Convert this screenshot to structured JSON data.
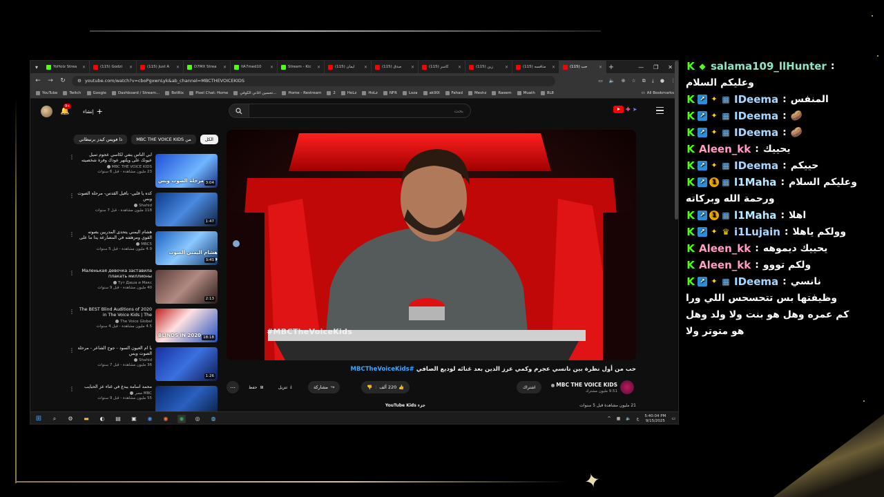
{
  "browser": {
    "tabs": [
      {
        "label": "YoHolz Strea",
        "color": "#53fc18"
      },
      {
        "label": "(115) Godzi",
        "color": "#ff0000"
      },
      {
        "label": "(115) Just A",
        "color": "#ff0000"
      },
      {
        "label": "D7MX Strea",
        "color": "#53fc18"
      },
      {
        "label": "llA7med10",
        "color": "#53fc18"
      },
      {
        "label": "Stream - Kic",
        "color": "#53fc18"
      },
      {
        "label": "(115) ايمان",
        "color": "#ff0000"
      },
      {
        "label": "(115) صدق",
        "color": "#ff0000"
      },
      {
        "label": "(115) كاسر",
        "color": "#ff0000"
      },
      {
        "label": "(115) زين",
        "color": "#ff0000"
      },
      {
        "label": "(115) منافسه",
        "color": "#ff0000"
      },
      {
        "label": "(115) حب",
        "color": "#ff0000",
        "active": true
      }
    ],
    "url": "youtube.com/watch?v=cboPgxwnLyk&ab_channel=MBCTHEVOICEKIDS",
    "bookmarks": [
      "YouTube",
      "Twitch",
      "Google",
      "Dashboard / Stream...",
      "BotRix",
      "Pixel Chat: Home",
      "تحسين اغاني الكوفي...",
      "Home - Restream",
      "2",
      "HoLz",
      "HoLz",
      "NFR",
      "Loza",
      "ak90l",
      "Fahad",
      "Meshz",
      "Raeem",
      "Muath",
      "8L8"
    ],
    "all_bookmarks": "All Bookmarks"
  },
  "youtube": {
    "search_placeholder": "بحث",
    "create_label": "إنشاء",
    "notification_count": "9+",
    "chips": [
      {
        "label": "الكل",
        "active": true
      },
      {
        "label": "من MBC THE VOICE KIDS",
        "active": false
      },
      {
        "label": "ذا فويس كيدز برنبطاني",
        "active": false
      }
    ],
    "recommendations": [
      {
        "title": "أبي الناس ينفي لكاسي عجوم تميل عيونك على ويلتهر عودك وفرة شخصيته",
        "channel": "MBC THE VOICE KIDS",
        "views": "23 مليون مشاهدة - قبل 6 سنوات",
        "duration": "3:04",
        "caption": "مرحلة الصوت وبس"
      },
      {
        "title": "كده يا قلبي- بأفيل القدس- مرحلة الصوت وبس",
        "channel": "Shahid",
        "views": "118 مليون مشاهدة - قبل 7 سنوات",
        "duration": "1:47",
        "caption": ""
      },
      {
        "title": "هشام اليمني يتحدى المدربين بصوته القوي ومرهفته في المصارعة يدا ما على نالسي ف",
        "channel": "MBC5",
        "views": "4.9 مليون مشاهدة - قبل 5 سنوات",
        "duration": "3:41",
        "caption": "هشام اليمني الصوت وبس"
      },
      {
        "title": "Маленькая девочка заставила плакать миллионы",
        "channel": "Тут Даша и Макс",
        "views": "40 مليون مشاهدة - قبل 9 سنوات",
        "duration": "2:13",
        "caption": ""
      },
      {
        "title": "The BEST Blind Auditions of 2020 in The Voice Kids | The",
        "channel": "The Voice Global",
        "views": "4.5 مليون مشاهدة - قبل 4 سنوات",
        "duration": "18:18",
        "caption": "BLINDS IN 2020"
      },
      {
        "title": "يا أم العيون السود - جوح الشاعر - مرحلة الصوت وبس",
        "channel": "Shahid",
        "views": "36 مليون مشاهدة - قبل 7 سنوات",
        "duration": "1:26",
        "caption": ""
      },
      {
        "title": "محمد أسامة يبدع في غناء عز الحبايب",
        "channel": "MBC مصر",
        "views": "55 مليون مشاهدة - قبل 9 سنوات",
        "duration": "1:54",
        "caption": ""
      }
    ],
    "video": {
      "watermark": "#MBCTheVoiceKids",
      "title": "حب من أول نظرة بين نانسي عجرم وكمي عرز الدين بعد غنائه لوديع الصافي",
      "title_tag": "#MBCTheVoiceKids",
      "channel": "MBC THE VOICE KIDS",
      "subscribers": "9.51 مليون مشترك",
      "subscribe": "اشتراك",
      "likes": "220 ألف",
      "share": "مشاركة",
      "download": "تنزيل",
      "save": "حفظ",
      "stats": "21 مليون مشاهدة قبل 5 سنوات",
      "kids": "جزء YouTube Kids"
    }
  },
  "taskbar": {
    "time": "5:40:04 PM",
    "date": "9/15/2025",
    "lang": "ع"
  },
  "chat": {
    "messages": [
      {
        "user": "salama109_llHunter",
        "cls": "u-salama",
        "badges": [
          "k",
          "diamond"
        ],
        "text": "وعليكم السلام",
        "newline": true
      },
      {
        "user": "IDeema",
        "cls": "u-deema",
        "badges": [
          "k",
          "arrow",
          "star",
          "grid"
        ],
        "text": "المنفس"
      },
      {
        "user": "IDeema",
        "cls": "u-deema",
        "badges": [
          "k",
          "arrow",
          "star",
          "grid"
        ],
        "text": "🥔"
      },
      {
        "user": "IDeema",
        "cls": "u-deema",
        "badges": [
          "k",
          "arrow",
          "star",
          "grid"
        ],
        "text": "🥔"
      },
      {
        "user": "Aleen_kk",
        "cls": "u-aleen",
        "badges": [
          "k"
        ],
        "text": "يحييك"
      },
      {
        "user": "IDeema",
        "cls": "u-deema",
        "badges": [
          "k",
          "arrow",
          "star",
          "grid"
        ],
        "text": "حييكم"
      },
      {
        "user": "l1Maha",
        "cls": "u-maha",
        "badges": [
          "k",
          "arrow",
          "one",
          "grid"
        ],
        "text": "وعليكم السلام",
        "extra": "ورحمة الله وبركاته"
      },
      {
        "user": "l1Maha",
        "cls": "u-maha",
        "badges": [
          "k",
          "arrow",
          "one",
          "grid"
        ],
        "text": "اهلا"
      },
      {
        "user": "i1Lujain",
        "cls": "u-lujain",
        "badges": [
          "k",
          "arrow",
          "star",
          "crown"
        ],
        "text": "وولكم ياهلا"
      },
      {
        "user": "Aleen_kk",
        "cls": "u-aleen",
        "badges": [
          "k"
        ],
        "text": "يحييك ديموهه"
      },
      {
        "user": "Aleen_kk",
        "cls": "u-aleen",
        "badges": [
          "k"
        ],
        "text": "ولكم تووو"
      },
      {
        "user": "IDeema",
        "cls": "u-deema",
        "badges": [
          "k",
          "arrow",
          "star",
          "grid"
        ],
        "text": "نانسي",
        "extra": "وظيفتها بس تتحسحس اللي ورا كم عمره وهل هو بنت ولا ولد وهل هو متوتر ولا"
      }
    ]
  }
}
